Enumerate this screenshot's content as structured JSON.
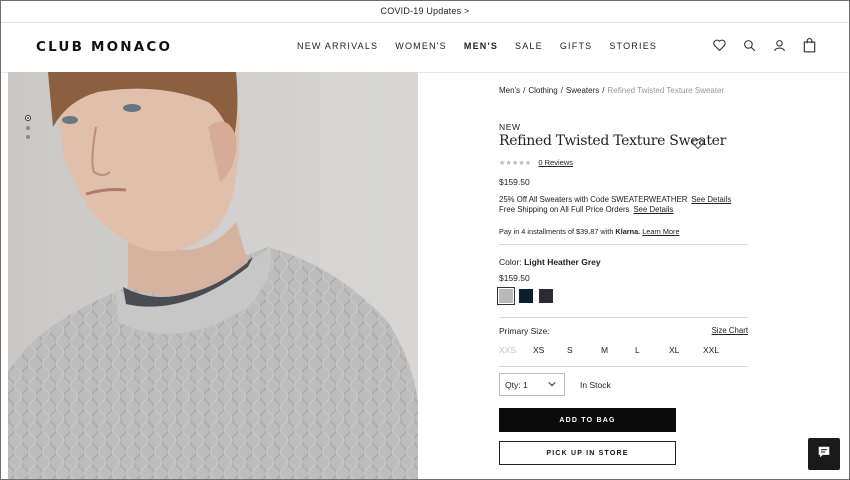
{
  "promo_bar": {
    "text": "COVID-19 Updates >"
  },
  "header": {
    "logo": "CLUB MONACO",
    "nav": [
      {
        "label": "NEW ARRIVALS",
        "active": false
      },
      {
        "label": "WOMEN'S",
        "active": false
      },
      {
        "label": "MEN'S",
        "active": true
      },
      {
        "label": "SALE",
        "active": false
      },
      {
        "label": "GIFTS",
        "active": false
      },
      {
        "label": "STORIES",
        "active": false
      }
    ],
    "icons": [
      "heart-icon",
      "search-icon",
      "account-icon",
      "bag-icon"
    ]
  },
  "gallery": {
    "image_count": 3,
    "active_index": 0
  },
  "breadcrumb": {
    "items": [
      "Men's",
      "Clothing",
      "Sweaters"
    ],
    "current": "Refined Twisted Texture Sweater"
  },
  "product": {
    "badge": "NEW",
    "title": "Refined Twisted Texture Sweater",
    "stars": "★★★★★",
    "rating": 0,
    "reviews_label": "0 Reviews",
    "price": "$159.50",
    "promo_line": "25% Off All Sweaters with Code SWEATERWEATHER",
    "promo_link": "See Details",
    "shipping_line": "Free Shipping on All Full Price Orders",
    "shipping_link": "See Details",
    "klarna_prefix": "Pay in 4 installments of $39.87 with",
    "klarna_brand": "Klarna.",
    "klarna_link": "Learn More"
  },
  "color": {
    "label": "Color:",
    "selected": "Light Heather Grey",
    "price": "$159.50",
    "swatches": [
      {
        "name": "Light Heather Grey",
        "hex": "#b9b9bb",
        "selected": true
      },
      {
        "name": "Navy",
        "hex": "#0e1e2e",
        "selected": false
      },
      {
        "name": "Charcoal",
        "hex": "#2b2a36",
        "selected": false
      }
    ]
  },
  "size": {
    "label": "Primary Size:",
    "chart_link": "Size Chart",
    "options": [
      {
        "label": "XXS",
        "available": false
      },
      {
        "label": "XS",
        "available": true
      },
      {
        "label": "S",
        "available": true
      },
      {
        "label": "M",
        "available": true
      },
      {
        "label": "L",
        "available": true
      },
      {
        "label": "XL",
        "available": true
      },
      {
        "label": "XXL",
        "available": true
      }
    ]
  },
  "purchase": {
    "qty_label": "Qty: 1",
    "stock": "In Stock",
    "add_to_bag": "ADD TO BAG",
    "pick_up": "PICK UP IN STORE"
  },
  "colors": {
    "accent": "#0b0b0b",
    "unavailable": "#c2c2c2",
    "hero_bg": "#d0cfcd"
  }
}
